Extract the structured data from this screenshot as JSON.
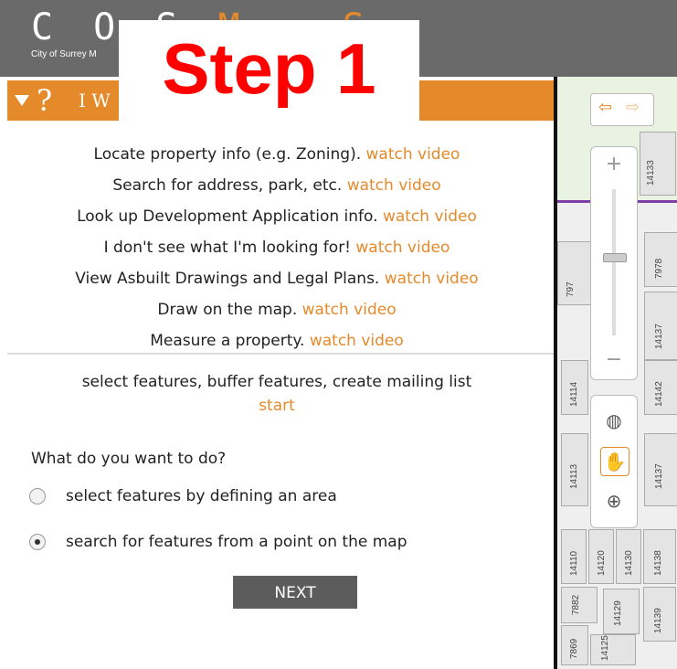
{
  "app": {
    "logo_text": "C O S",
    "logo_extra": "M ~ S",
    "logo_sub": "City of Surrey M"
  },
  "overlay": {
    "step_label": "Step 1"
  },
  "panel": {
    "header_text": "I W",
    "help_items": [
      {
        "text": "Locate property info (e.g. Zoning).",
        "link": "watch video"
      },
      {
        "text": "Search for address, park, etc.",
        "link": "watch video"
      },
      {
        "text": "Look up Development Application info.",
        "link": "watch video"
      },
      {
        "text": "I don't see what I'm looking for!",
        "link": "watch video"
      },
      {
        "text": "View Asbuilt Drawings and Legal Plans.",
        "link": "watch video"
      },
      {
        "text": "Draw on the map.",
        "link": "watch video"
      },
      {
        "text": "Measure a property.",
        "link": "watch video"
      }
    ],
    "select_title": "select features, buffer features, create mailing list",
    "start_link": "start",
    "question": "What do you want to do?",
    "options": [
      {
        "label": "select features by defining an area",
        "checked": false
      },
      {
        "label": "search for features from a point on the map",
        "checked": true
      }
    ],
    "next_label": "NEXT"
  },
  "map": {
    "zoom_in": "+",
    "zoom_out": "−",
    "zoom_level": 0.62,
    "parcel_labels": [
      "14133",
      "7978",
      "797",
      "14137",
      "14114",
      "14142",
      "14113",
      "14137",
      "14110",
      "14120",
      "14130",
      "14138",
      "14139",
      "7882",
      "14129",
      "7869",
      "14125"
    ]
  },
  "colors": {
    "accent": "#e58a2a",
    "topbar": "#6a6a6a",
    "step_text": "#ff0000"
  }
}
